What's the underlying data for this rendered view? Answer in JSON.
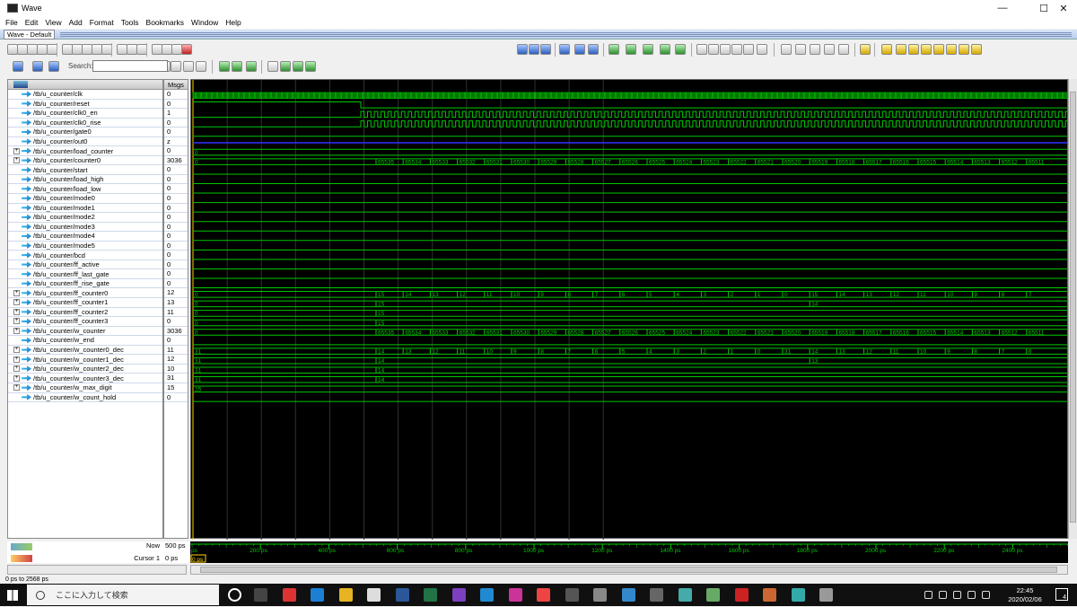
{
  "window": {
    "title": "Wave",
    "subwindow_title": "Wave - Default"
  },
  "menu": [
    "File",
    "Edit",
    "View",
    "Add",
    "Format",
    "Tools",
    "Bookmarks",
    "Window",
    "Help"
  ],
  "search": {
    "label": "Search:"
  },
  "panes": {
    "msgs_header": "Msgs"
  },
  "signals": [
    {
      "name": "/tb/u_counter/clk",
      "value": "0",
      "bus": false
    },
    {
      "name": "/tb/u_counter/reset",
      "value": "0",
      "bus": false
    },
    {
      "name": "/tb/u_counter/clk0_en",
      "value": "1",
      "bus": false
    },
    {
      "name": "/tb/u_counter/clk0_rise",
      "value": "0",
      "bus": false
    },
    {
      "name": "/tb/u_counter/gate0",
      "value": "0",
      "bus": false
    },
    {
      "name": "/tb/u_counter/out0",
      "value": "z",
      "bus": false
    },
    {
      "name": "/tb/u_counter/load_counter",
      "value": "0",
      "bus": true
    },
    {
      "name": "/tb/u_counter/counter0",
      "value": "3036",
      "bus": true
    },
    {
      "name": "/tb/u_counter/start",
      "value": "0",
      "bus": false
    },
    {
      "name": "/tb/u_counter/load_high",
      "value": "0",
      "bus": false
    },
    {
      "name": "/tb/u_counter/load_low",
      "value": "0",
      "bus": false
    },
    {
      "name": "/tb/u_counter/mode0",
      "value": "0",
      "bus": false
    },
    {
      "name": "/tb/u_counter/mode1",
      "value": "0",
      "bus": false
    },
    {
      "name": "/tb/u_counter/mode2",
      "value": "0",
      "bus": false
    },
    {
      "name": "/tb/u_counter/mode3",
      "value": "0",
      "bus": false
    },
    {
      "name": "/tb/u_counter/mode4",
      "value": "0",
      "bus": false
    },
    {
      "name": "/tb/u_counter/mode5",
      "value": "0",
      "bus": false
    },
    {
      "name": "/tb/u_counter/bcd",
      "value": "0",
      "bus": false
    },
    {
      "name": "/tb/u_counter/ff_active",
      "value": "0",
      "bus": false
    },
    {
      "name": "/tb/u_counter/ff_last_gate",
      "value": "0",
      "bus": false
    },
    {
      "name": "/tb/u_counter/ff_rise_gate",
      "value": "0",
      "bus": false
    },
    {
      "name": "/tb/u_counter/ff_counter0",
      "value": "12",
      "bus": true
    },
    {
      "name": "/tb/u_counter/ff_counter1",
      "value": "13",
      "bus": true
    },
    {
      "name": "/tb/u_counter/ff_counter2",
      "value": "11",
      "bus": true
    },
    {
      "name": "/tb/u_counter/ff_counter3",
      "value": "0",
      "bus": true
    },
    {
      "name": "/tb/u_counter/w_counter",
      "value": "3036",
      "bus": true
    },
    {
      "name": "/tb/u_counter/w_end",
      "value": "0",
      "bus": false
    },
    {
      "name": "/tb/u_counter/w_counter0_dec",
      "value": "11",
      "bus": true
    },
    {
      "name": "/tb/u_counter/w_counter1_dec",
      "value": "12",
      "bus": true
    },
    {
      "name": "/tb/u_counter/w_counter2_dec",
      "value": "10",
      "bus": true
    },
    {
      "name": "/tb/u_counter/w_counter3_dec",
      "value": "31",
      "bus": true
    },
    {
      "name": "/tb/u_counter/w_max_digit",
      "value": "15",
      "bus": true
    },
    {
      "name": "/tb/u_counter/w_count_hold",
      "value": "0",
      "bus": false
    }
  ],
  "waves": {
    "initial_zero_label": "0",
    "counter_labels": [
      "65535",
      "65534",
      "65533",
      "65532",
      "65531",
      "65530",
      "65529",
      "65528",
      "65527",
      "65526",
      "65525",
      "65524",
      "65523",
      "65522",
      "65521",
      "65520",
      "65519",
      "65518",
      "65517",
      "65516",
      "65515",
      "65514",
      "65513",
      "65512",
      "65511"
    ],
    "ff0_labels": [
      "15",
      "14",
      "13",
      "12",
      "11",
      "10",
      "9",
      "8",
      "7",
      "6",
      "5",
      "4",
      "3",
      "2",
      "1",
      "0",
      "15",
      "14",
      "13",
      "12",
      "11",
      "10",
      "9",
      "8",
      "7"
    ],
    "ff1_labels": [
      "15",
      "14"
    ],
    "ff2_labels": [
      "15"
    ],
    "ff3_labels": [
      "15"
    ],
    "dec0_labels": [
      "14",
      "13",
      "12",
      "11",
      "10",
      "9",
      "8",
      "7",
      "6",
      "5",
      "4",
      "3",
      "2",
      "1",
      "0",
      "31",
      "14",
      "13",
      "12",
      "11",
      "10",
      "9",
      "8",
      "7",
      "6"
    ],
    "dec1_labels": [
      "14",
      "13"
    ],
    "dec2_labels": [
      "14"
    ],
    "dec3_labels": [
      "14"
    ],
    "dec_initial": "31",
    "max_digit_label": "15"
  },
  "cursor": {
    "now_label": "Now",
    "now_value": "500 ps",
    "cursor_label": "Cursor 1",
    "cursor_value": "0 ps",
    "cursor_flag": "0 ps"
  },
  "timeline": {
    "start_label": "ps",
    "ticks": [
      "200 ps",
      "400 ps",
      "600 ps",
      "800 ps",
      "1000 ps",
      "1200 ps",
      "1400 ps",
      "1600 ps",
      "1800 ps",
      "2000 ps",
      "2200 ps",
      "2400 ps"
    ]
  },
  "status": {
    "range": "0 ps to 2568 ps"
  },
  "taskbar": {
    "search_placeholder": "ここに入力して検索",
    "time": "22:45",
    "date": "2020/02/06",
    "notif_count": "4"
  },
  "colors": {
    "wave": "#00c800",
    "background": "#000000",
    "bus_z": "#3030ff",
    "cursor": "#ffd200"
  }
}
